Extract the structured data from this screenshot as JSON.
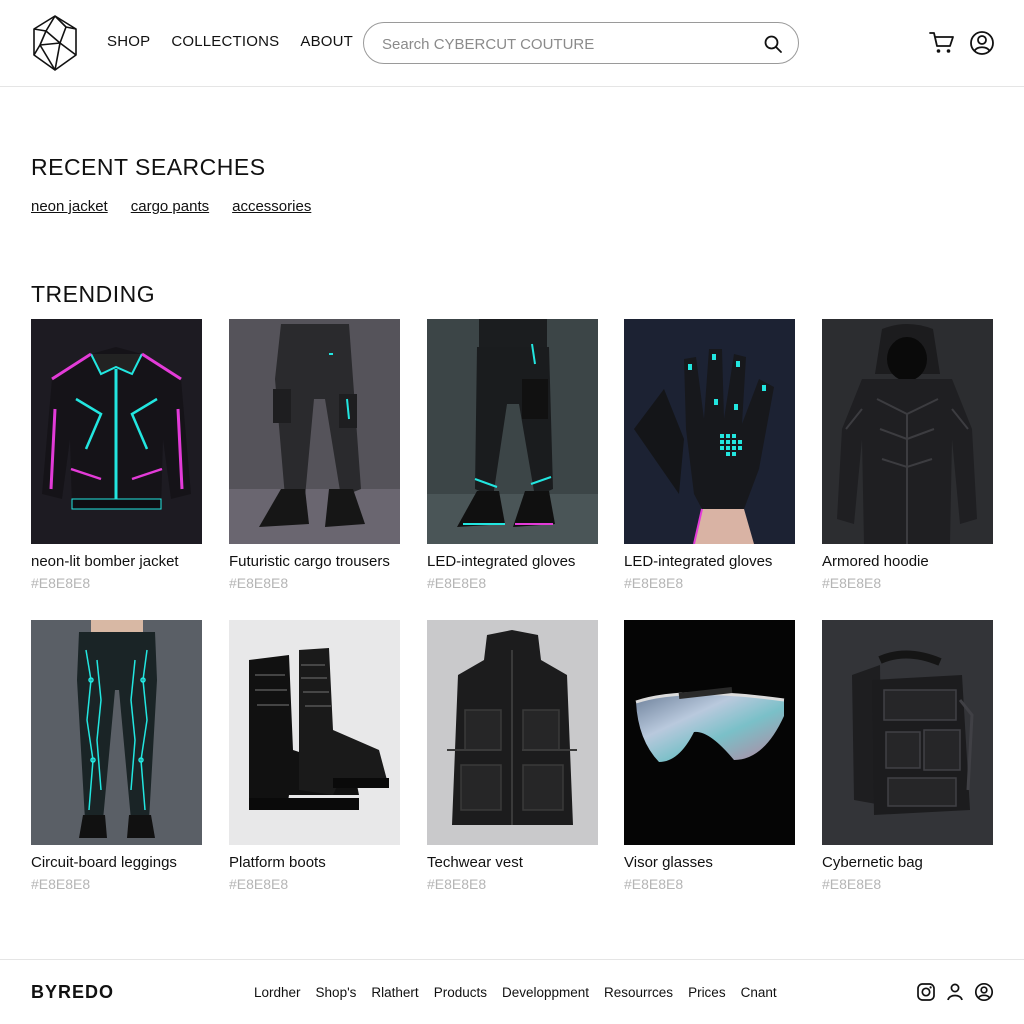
{
  "header": {
    "nav": [
      "SHOP",
      "COLLECTIONS",
      "ABOUT"
    ],
    "search_placeholder": "Search CYBERCUT COUTURE"
  },
  "recent": {
    "title": "RECENT SEARCHES",
    "links": [
      "neon jacket",
      "cargo pants",
      "accessories"
    ]
  },
  "trending": {
    "title": "TRENDING",
    "products": [
      {
        "name": "neon-lit bomber jacket",
        "code": "#E8E8E8"
      },
      {
        "name": "Futuristic cargo trousers",
        "code": "#E8E8E8"
      },
      {
        "name": "LED-integrated gloves",
        "code": "#E8E8E8"
      },
      {
        "name": "LED-integrated gloves",
        "code": "#E8E8E8"
      },
      {
        "name": "Armored hoodie",
        "code": "#E8E8E8"
      },
      {
        "name": "Circuit-board leggings",
        "code": "#E8E8E8"
      },
      {
        "name": "Platform boots",
        "code": "#E8E8E8"
      },
      {
        "name": "Techwear vest",
        "code": "#E8E8E8"
      },
      {
        "name": "Visor glasses",
        "code": "#E8E8E8"
      },
      {
        "name": "Cybernetic bag",
        "code": "#E8E8E8"
      }
    ]
  },
  "footer": {
    "brand": "BYREDO",
    "links": [
      "Lordher",
      "Shop's",
      "Rlathert",
      "Products",
      "Developpment",
      "Resourrces",
      "Prices",
      "Cnant"
    ]
  },
  "icons": {
    "logo": "geometric-crystal-logo-icon",
    "search": "search-icon",
    "cart": "cart-icon",
    "account": "user-circle-icon",
    "instagram": "instagram-icon",
    "person": "person-icon",
    "user": "user-circle-icon"
  },
  "colors": {
    "neon_cyan": "#22e6e0",
    "neon_magenta": "#e33bd8",
    "code_gray": "#b5b5b5"
  }
}
